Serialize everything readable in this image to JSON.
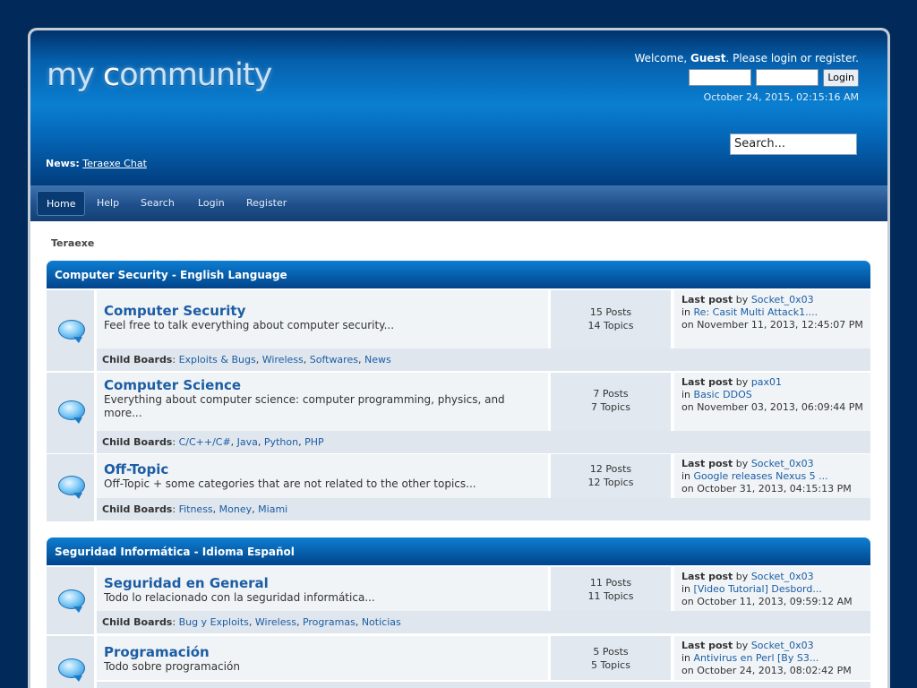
{
  "logo": {
    "text_pre": "my ",
    "text_c": "c",
    "text_post": "ommunity"
  },
  "user": {
    "welcome_pre": "Welcome, ",
    "guest": "Guest",
    "welcome_mid": ". Please ",
    "login_link": "login",
    "or": " or ",
    "register_link": "register",
    "period": ".",
    "login_button": "Login",
    "datetime": "October 24, 2015, 02:15:16 AM"
  },
  "search": {
    "placeholder": "Search..."
  },
  "news": {
    "label": "News:",
    "link": "Teraexe Chat"
  },
  "menu": {
    "items": [
      {
        "label": "Home"
      },
      {
        "label": "Help"
      },
      {
        "label": "Search"
      },
      {
        "label": "Login"
      },
      {
        "label": "Register"
      }
    ]
  },
  "breadcrumb": "Teraexe",
  "categories": [
    {
      "title": "Computer Security - English Language"
    },
    {
      "title": "Seguridad Informática - Idioma Español"
    }
  ],
  "labels": {
    "child_boards": "Child Boards",
    "last_post": "Last post",
    "by": " by ",
    "in": "in ",
    "on": "on "
  },
  "boards": [
    {
      "name": "Computer Security",
      "desc": "Feel free to talk everything about computer security...",
      "posts": "15 Posts",
      "topics": "14 Topics",
      "lp_user": "Socket_0x03",
      "lp_topic": "Re: Casit Multi Attack1....",
      "lp_date": "November 11, 2013, 12:45:07 PM",
      "children": [
        "Exploits & Bugs",
        "Wireless",
        "Softwares",
        "News"
      ]
    },
    {
      "name": "Computer Science",
      "desc": "Everything about computer science: computer programming, physics, and more...",
      "posts": "7 Posts",
      "topics": "7 Topics",
      "lp_user": "pax01",
      "lp_topic": "Basic DDOS",
      "lp_date": "November 03, 2013, 06:09:44 PM",
      "children": [
        "C/C++/C#",
        "Java",
        "Python",
        "PHP"
      ]
    },
    {
      "name": "Off-Topic",
      "desc": "Off-Topic + some categories that are not related to the other topics...",
      "posts": "12 Posts",
      "topics": "12 Topics",
      "lp_user": "Socket_0x03",
      "lp_topic": "Google releases Nexus 5 ...",
      "lp_date": "October 31, 2013, 04:15:13 PM",
      "children": [
        "Fitness",
        "Money",
        "Miami"
      ]
    },
    {
      "name": "Seguridad en General",
      "desc": "Todo lo relacionado con la seguridad informática...",
      "posts": "11 Posts",
      "topics": "11 Topics",
      "lp_user": "Socket_0x03",
      "lp_topic": "[Video Tutorial] Desbord...",
      "lp_date": "October 11, 2013, 09:59:12 AM",
      "children": [
        "Bug y Exploits",
        "Wireless",
        "Programas",
        "Noticias"
      ]
    },
    {
      "name": "Programación",
      "desc": "Todo sobre programación",
      "posts": "5 Posts",
      "topics": "5 Topics",
      "lp_user": "Socket_0x03",
      "lp_topic": "Antivirus en Perl [By S3...",
      "lp_date": "October 24, 2013, 08:02:42 PM",
      "children": []
    }
  ],
  "colors": {
    "link": "#1c5da4",
    "background": "#012a5a",
    "category_bar": "#0761ad"
  }
}
